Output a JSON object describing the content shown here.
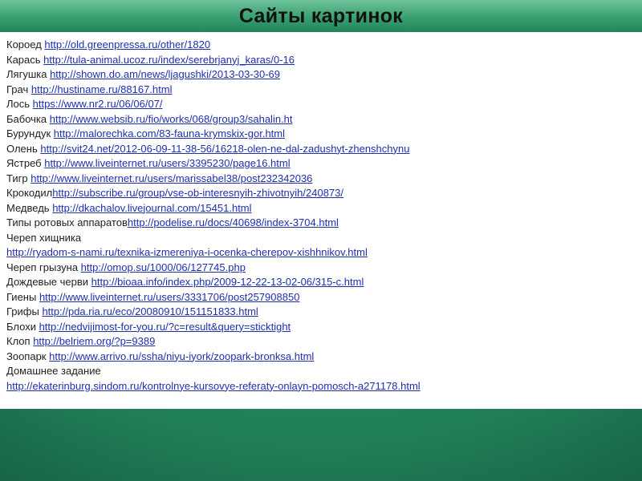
{
  "title": "Сайты картинок",
  "entries": [
    {
      "label": "Короед ",
      "url": "http://old.greenpressa.ru/other/1820"
    },
    {
      "label": "Карась ",
      "url": "http://tula-animal.ucoz.ru/index/serebrjanyj_karas/0-16"
    },
    {
      "label": "Лягушка ",
      "url": "http://shown.do.am/news/ljagushki/2013-03-30-69"
    },
    {
      "label": "Грач ",
      "url": "http://hustiname.ru/88167.html"
    },
    {
      "label": "Лось ",
      "url": "https://www.nr2.ru/06/06/07/"
    },
    {
      "label": "Бабочка ",
      "url": "http://www.websib.ru/fio/works/068/group3/sahalin.ht"
    },
    {
      "label": "Бурундук ",
      "url": "http://malorechka.com/83-fauna-krymskix-gor.html"
    },
    {
      "label": "Олень ",
      "url": "http://svit24.net/2012-06-09-11-38-56/16218-olen-ne-dal-zadushyt-zhenshchynu"
    },
    {
      "label": "Ястреб ",
      "url": "http://www.liveinternet.ru/users/3395230/page16.html"
    },
    {
      "label": "Тигр ",
      "url": "http://www.liveinternet.ru/users/marissabel38/post232342036"
    },
    {
      "label": "Крокодил",
      "url": "http://subscribe.ru/group/vse-ob-interesnyih-zhivotnyih/240873/"
    },
    {
      "label": "Медведь ",
      "url": "http://dkachalov.livejournal.com/15451.html"
    },
    {
      "label": "Типы ротовых аппаратов",
      "url": "http://podelise.ru/docs/40698/index-3704.html"
    },
    {
      "label": "Череп хищника",
      "url": ""
    },
    {
      "label": "",
      "url": "http://ryadom-s-nami.ru/texnika-izmereniya-i-ocenka-cherepov-xishhnikov.html"
    },
    {
      "label": "Череп грызуна ",
      "url": "http://omop.su/1000/06/127745.php"
    },
    {
      "label": "Дождевые черви ",
      "url": "http://bioaa.info/index.php/2009-12-22-13-02-06/315-c.html"
    },
    {
      "label": "Гиены ",
      "url": "http://www.liveinternet.ru/users/3331706/post257908850"
    },
    {
      "label": "Грифы ",
      "url": "http://pda.ria.ru/eco/20080910/151151833.html"
    },
    {
      "label": "Блохи ",
      "url": "http://nedvijimost-for-you.ru/?c=result&query=sticktight"
    },
    {
      "label": "Клоп ",
      "url": "http://belriem.org/?p=9389"
    },
    {
      "label": "Зоопарк ",
      "url": "http://www.arrivo.ru/ssha/niyu-iyork/zoopark-bronksa.html"
    },
    {
      "label": "Домашнее задание",
      "url": ""
    },
    {
      "label": "",
      "url": "http://ekaterinburg.sindom.ru/kontrolnye-kursovye-referaty-onlayn-pomosch-a271178.html"
    }
  ]
}
